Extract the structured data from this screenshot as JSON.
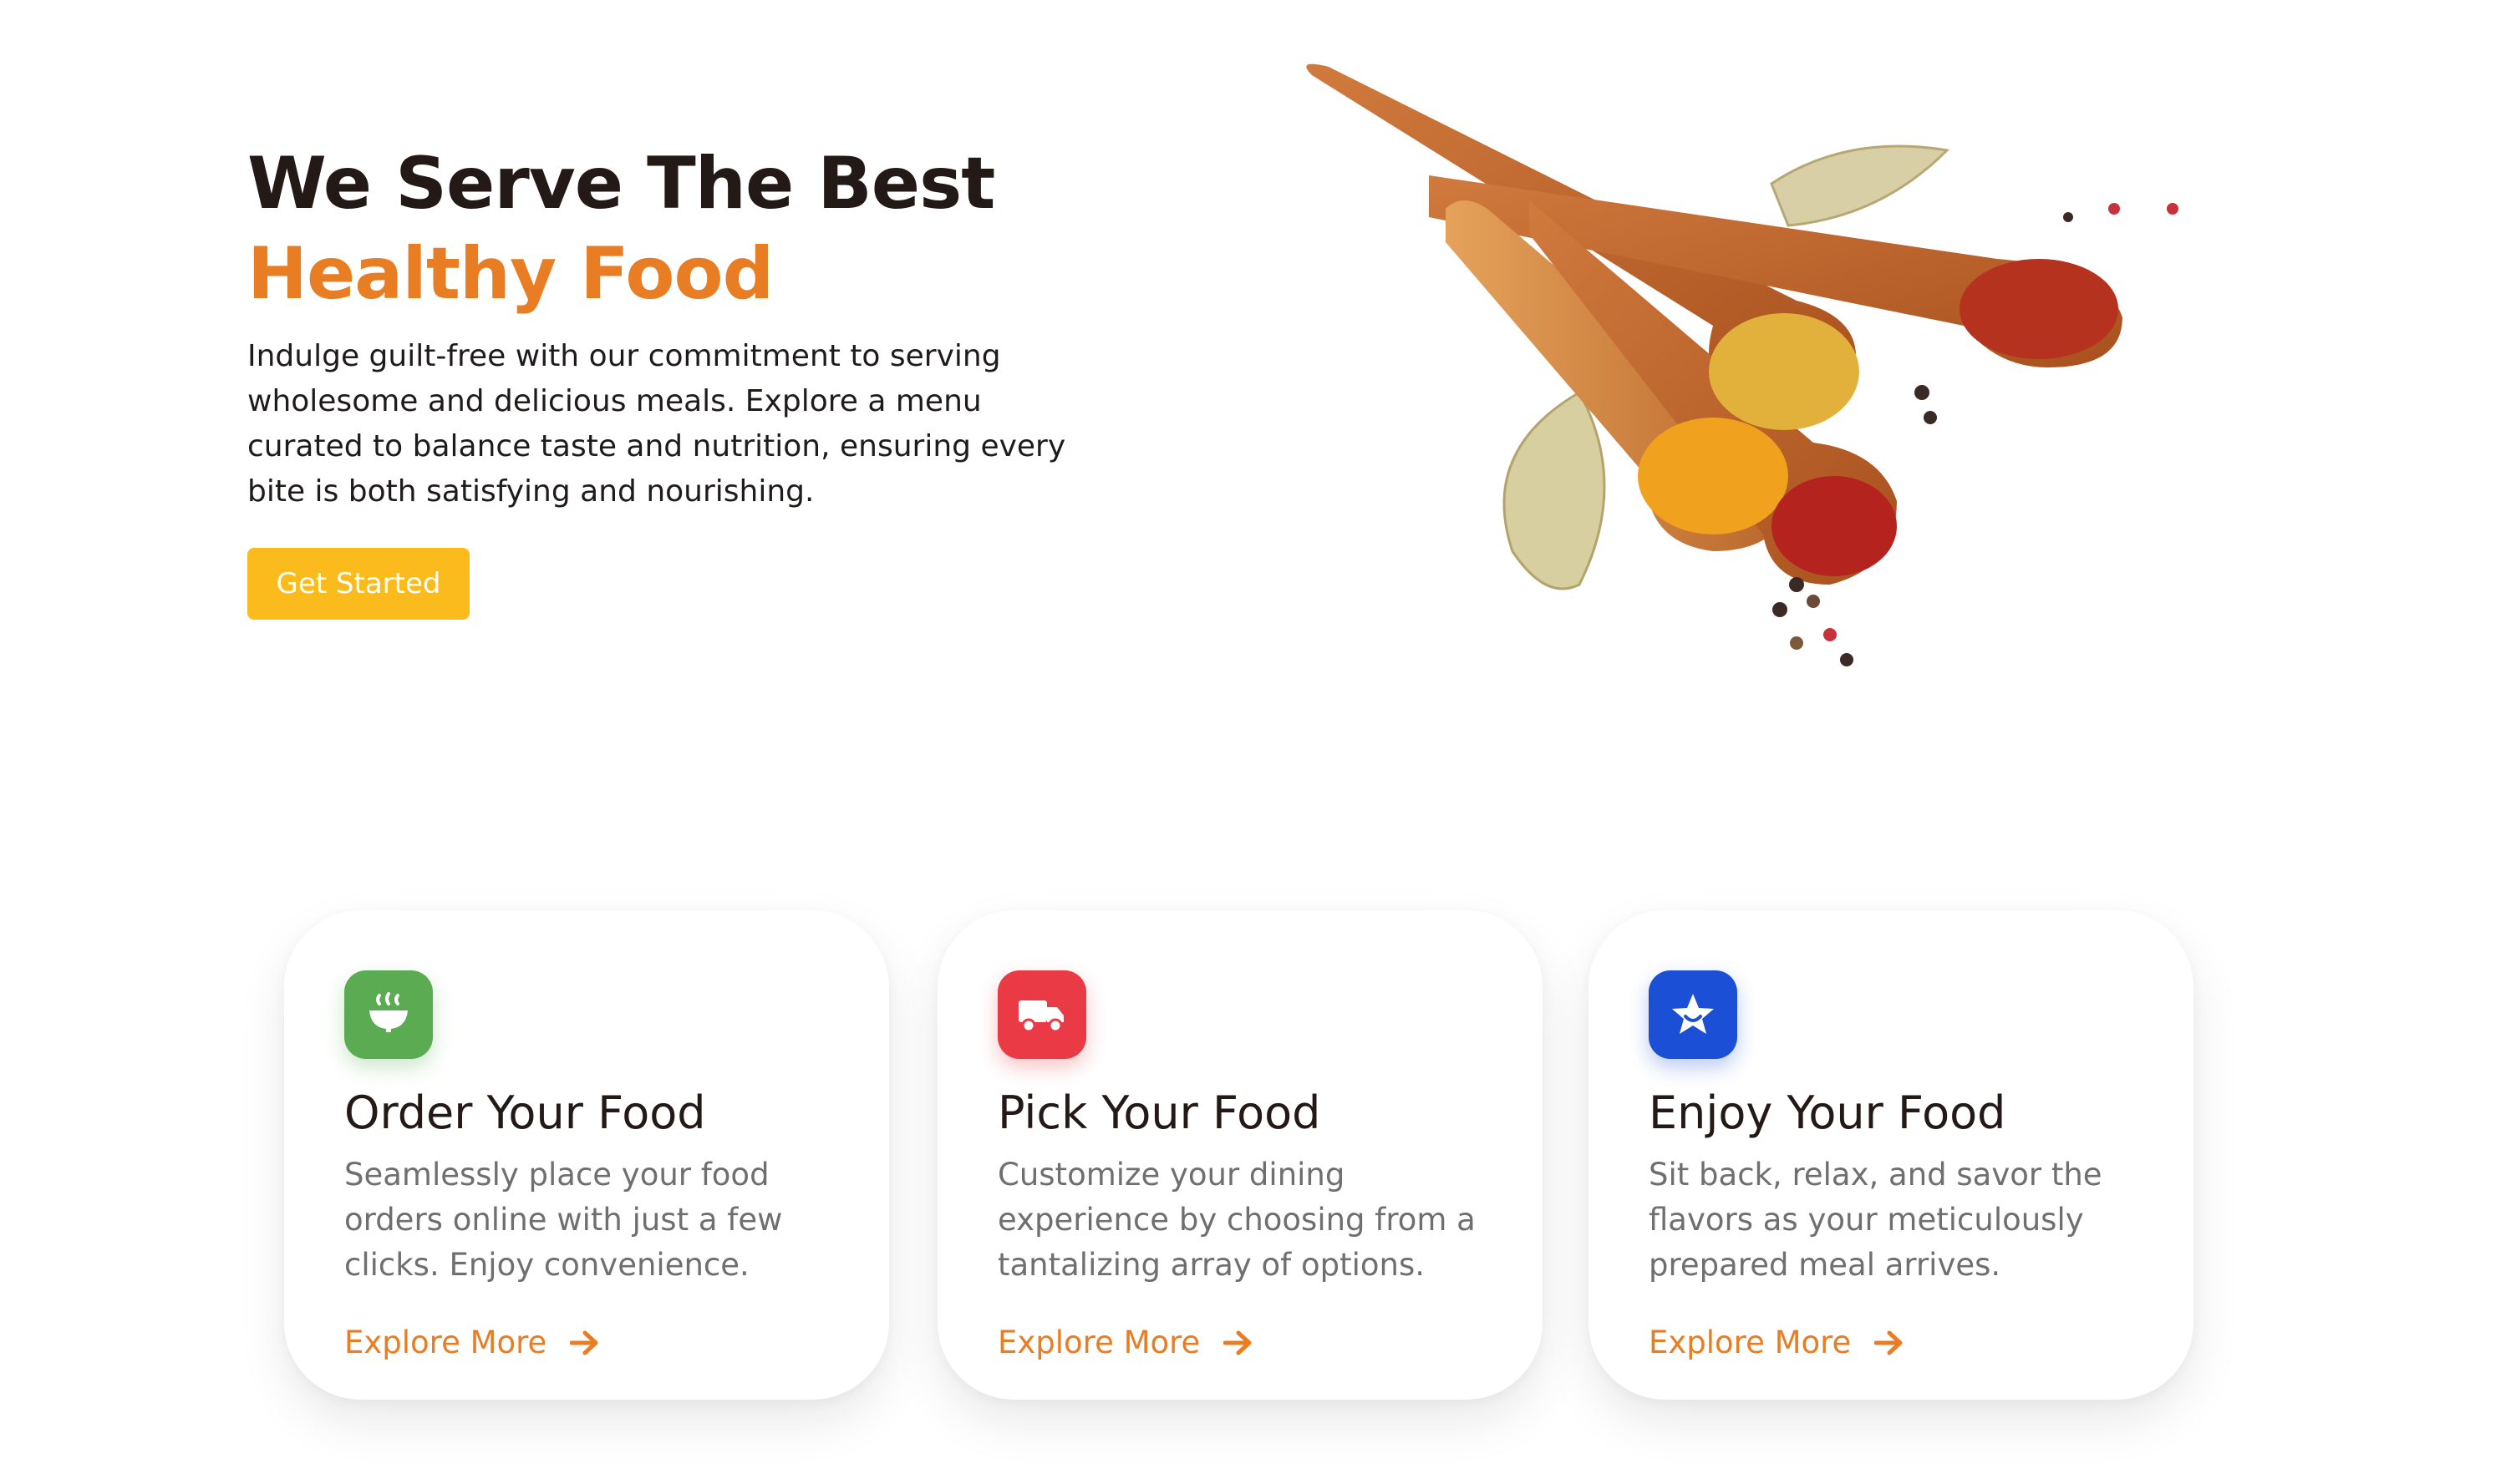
{
  "hero": {
    "title_line1": "We Serve The Best",
    "title_line2": "Healthy Food",
    "description": "Indulge guilt-free with our commitment to serving wholesome and delicious meals. Explore a menu curated to balance taste and nutrition, ensuring every bite is both satisfying and nourishing.",
    "cta_label": "Get Started",
    "image_icon": "spices-spoons-image"
  },
  "cards": [
    {
      "icon": "bowl-icon",
      "icon_color": "#5bab52",
      "title": "Order Your Food",
      "description": "Seamlessly place your food orders online with just a few clicks. Enjoy convenience.",
      "link_label": "Explore More"
    },
    {
      "icon": "truck-icon",
      "icon_color": "#ea3a45",
      "title": "Pick Your Food",
      "description": "Customize your dining experience by choosing from a tantalizing array of options.",
      "link_label": "Explore More"
    },
    {
      "icon": "star-badge-icon",
      "icon_color": "#1a4fd6",
      "title": "Enjoy Your Food",
      "description": "Sit back, relax, and savor the flavors as your meticulously prepared meal arrives.",
      "link_label": "Explore More"
    }
  ],
  "colors": {
    "accent": "#e97d24",
    "button": "#fbbb1d",
    "heading": "#231a18"
  }
}
